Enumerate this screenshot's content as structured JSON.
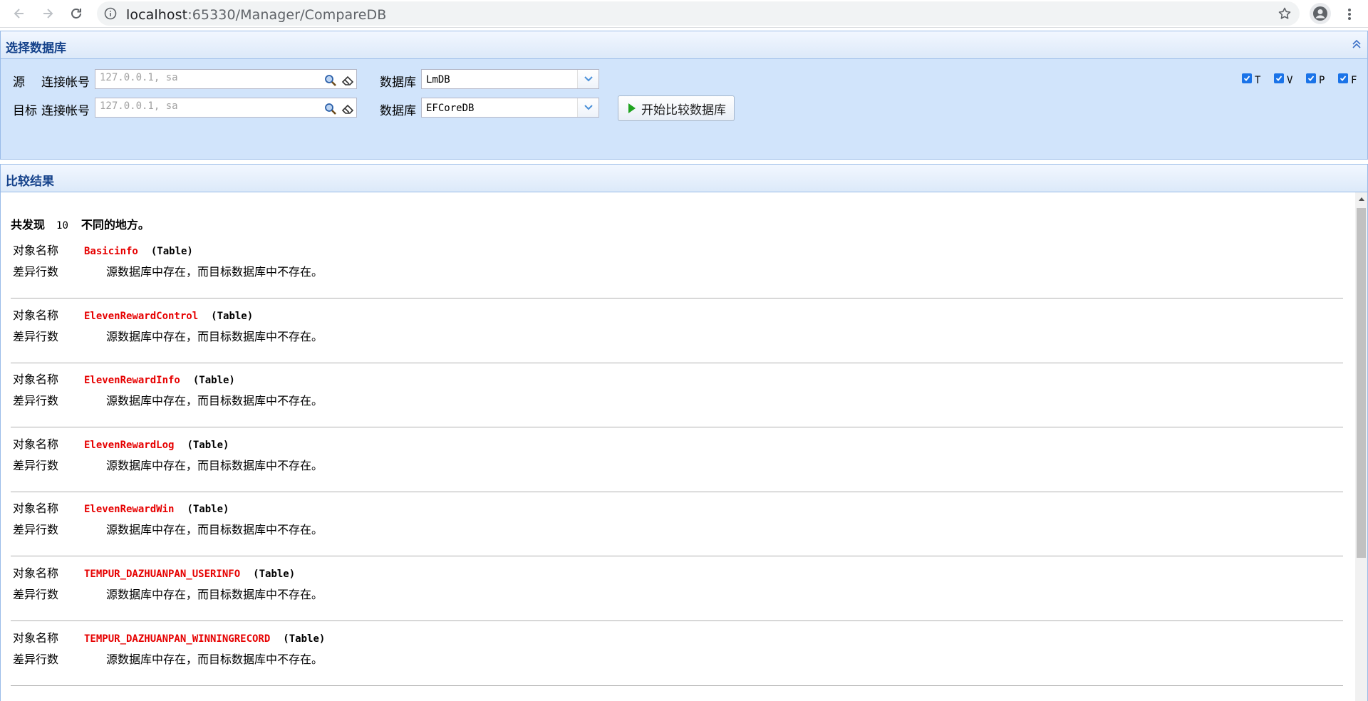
{
  "browser": {
    "url_host": "localhost",
    "url_rest": ":65330/Manager/CompareDB"
  },
  "select_panel": {
    "title": "选择数据库",
    "source": {
      "label": "源",
      "account_label": "连接帐号",
      "account_placeholder": "127.0.0.1, sa",
      "db_label": "数据库",
      "db_value": "LmDB"
    },
    "target": {
      "label": "目标",
      "account_label": "连接帐号",
      "account_placeholder": "127.0.0.1, sa",
      "db_label": "数据库",
      "db_value": "EFCoreDB"
    },
    "start_button": "开始比较数据库",
    "checkboxes": [
      {
        "label": "T",
        "checked": true
      },
      {
        "label": "V",
        "checked": true
      },
      {
        "label": "P",
        "checked": true
      },
      {
        "label": "F",
        "checked": true
      }
    ]
  },
  "result_panel": {
    "title": "比较结果",
    "summary_prefix": "共发现",
    "summary_count": "10",
    "summary_suffix": "不同的地方。",
    "object_name_label": "对象名称",
    "diff_rows_label": "差异行数",
    "items": [
      {
        "name": "Basicinfo",
        "type": "(Table)",
        "message": "源数据库中存在，而目标数据库中不存在。"
      },
      {
        "name": "ElevenRewardControl",
        "type": "(Table)",
        "message": "源数据库中存在，而目标数据库中不存在。"
      },
      {
        "name": "ElevenRewardInfo",
        "type": "(Table)",
        "message": "源数据库中存在，而目标数据库中不存在。"
      },
      {
        "name": "ElevenRewardLog",
        "type": "(Table)",
        "message": "源数据库中存在，而目标数据库中不存在。"
      },
      {
        "name": "ElevenRewardWin",
        "type": "(Table)",
        "message": "源数据库中存在，而目标数据库中不存在。"
      },
      {
        "name": "TEMPUR_DAZHUANPAN_USERINFO",
        "type": "(Table)",
        "message": "源数据库中存在，而目标数据库中不存在。"
      },
      {
        "name": "TEMPUR_DAZHUANPAN_WINNINGRECORD",
        "type": "(Table)",
        "message": "源数据库中存在，而目标数据库中不存在。"
      }
    ]
  }
}
